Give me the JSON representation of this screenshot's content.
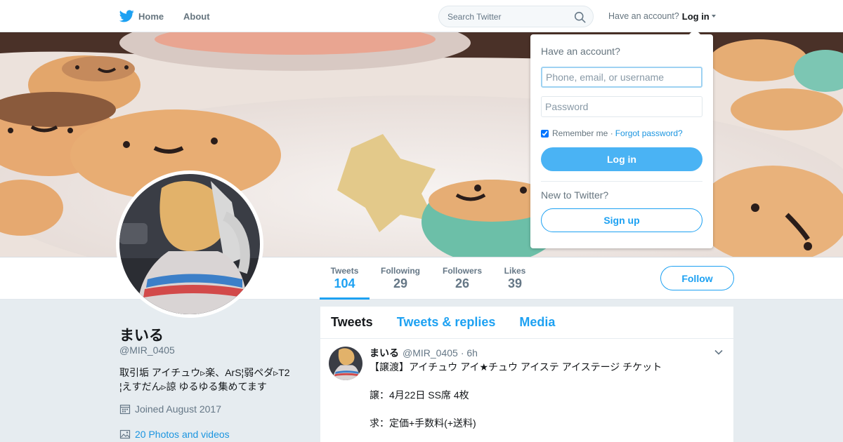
{
  "nav": {
    "home_label": "Home",
    "about_label": "About",
    "search_placeholder": "Search Twitter",
    "account_prompt": "Have an account?",
    "login_label": "Log in"
  },
  "profile_nav": {
    "stats": [
      {
        "label": "Tweets",
        "value": "104"
      },
      {
        "label": "Following",
        "value": "29"
      },
      {
        "label": "Followers",
        "value": "26"
      },
      {
        "label": "Likes",
        "value": "39"
      }
    ],
    "follow_label": "Follow"
  },
  "profile": {
    "name": "まいる",
    "handle": "@MIR_0405",
    "bio_line1": "取引垢 アイチュウ▹楽、ArS¦弱ペダ▹T2",
    "bio_line2": "¦えすだん▹諒 ゆるゆる集めてます",
    "joined": "Joined August 2017",
    "photos_link": "20 Photos and videos"
  },
  "timeline": {
    "tabs": [
      {
        "label": "Tweets"
      },
      {
        "label": "Tweets & replies"
      },
      {
        "label": "Media"
      }
    ],
    "tweet": {
      "name": "まいる",
      "handle": "@MIR_0405",
      "time": "· 6h",
      "line1": "【譲渡】アイチュウ アイ★チュウ アイステ アイステージ チケット",
      "line2": "譲：4月22日 SS席 4枚",
      "line3": "求：定価+手数料(+送料)"
    }
  },
  "login_dropdown": {
    "title": "Have an account?",
    "username_placeholder": "Phone, email, or username",
    "password_placeholder": "Password",
    "remember_label": "Remember me ·",
    "forgot_label": "Forgot password?",
    "remember_checked": true,
    "login_button": "Log in",
    "new_prompt": "New to Twitter?",
    "signup_button": "Sign up"
  },
  "colors": {
    "accent": "#1da1f2",
    "login_button": "#4ab3f4",
    "background": "#e6ecf0"
  },
  "icons": [
    "twitter-bird-icon",
    "home-nav",
    "search-icon",
    "caret-down-icon",
    "calendar-icon",
    "photo-icon",
    "chevron-down-icon"
  ]
}
